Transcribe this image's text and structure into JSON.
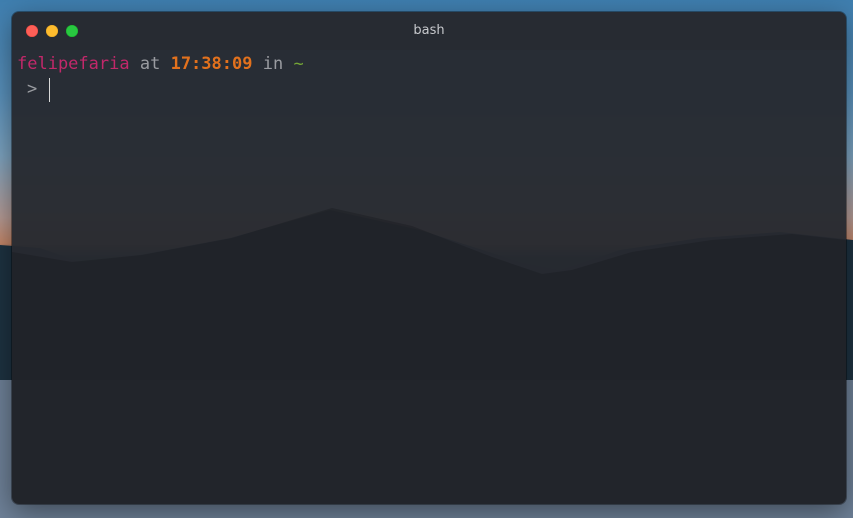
{
  "window": {
    "title": "bash"
  },
  "prompt": {
    "user": "felipefaria",
    "at": "at",
    "time": "17:38:09",
    "in": "in",
    "directory": "~"
  },
  "input": {
    "caret": ">",
    "value": ""
  },
  "colors": {
    "user": "#c2286a",
    "time": "#e2711d",
    "directory": "#74a536",
    "text": "#9a9ca1",
    "close": "#fe5f57",
    "minimize": "#febc2e",
    "maximize": "#28c840"
  }
}
